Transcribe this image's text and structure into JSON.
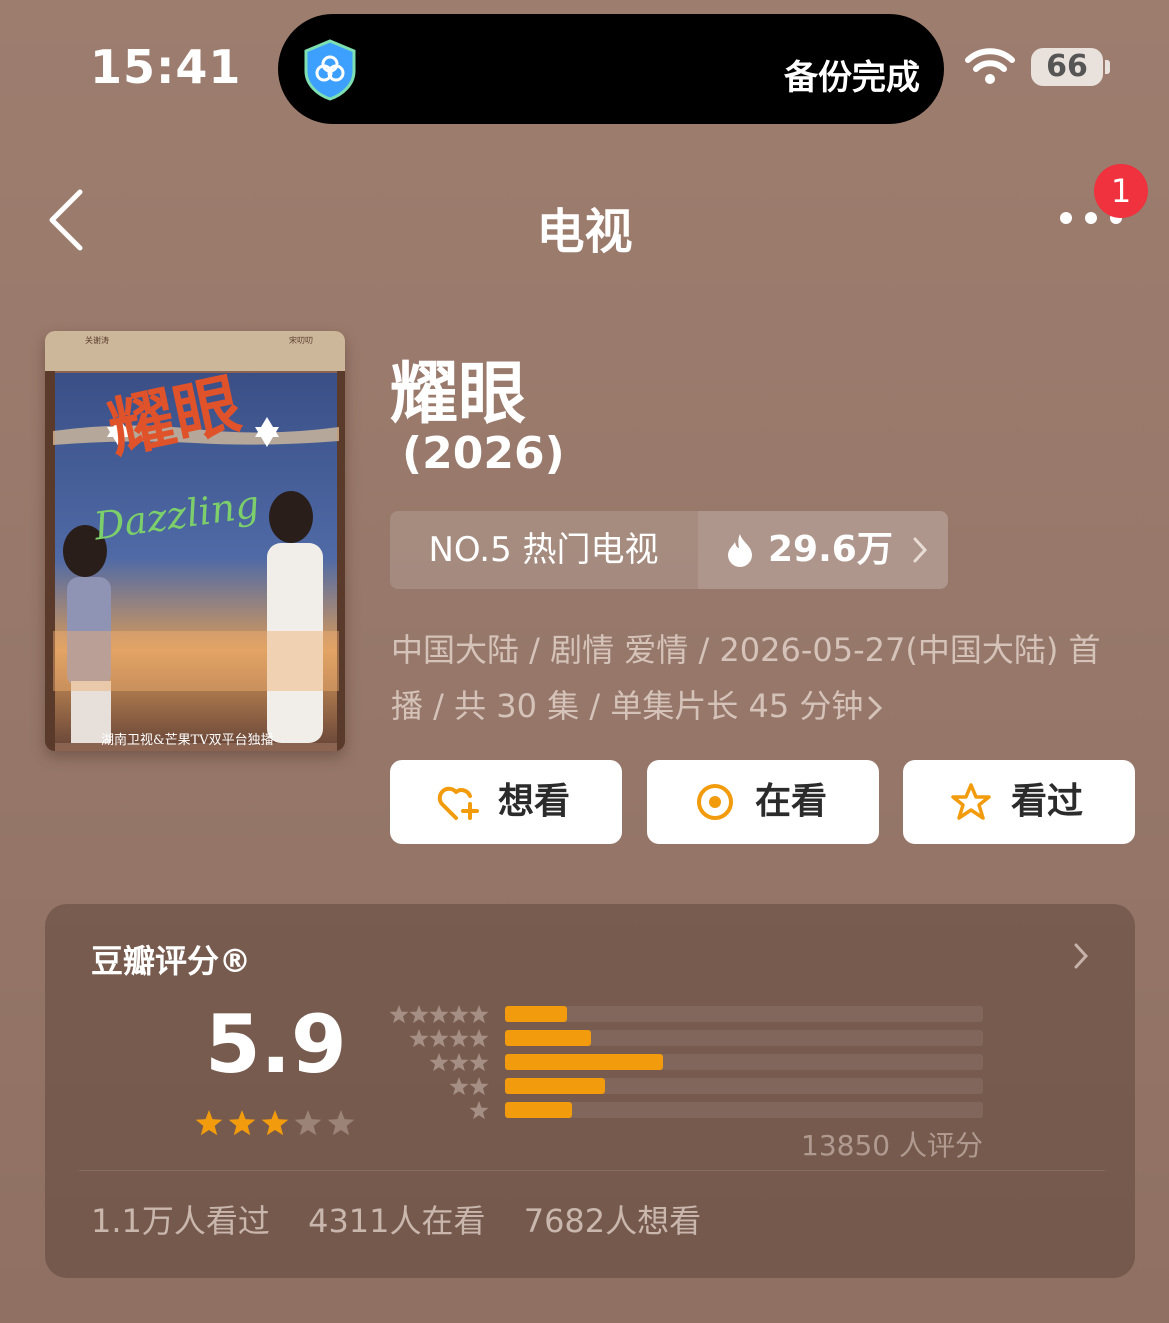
{
  "status_bar": {
    "time": "15:41",
    "backup_status": "备份完成",
    "battery": "66"
  },
  "nav": {
    "title": "电视",
    "notification_count": "1"
  },
  "poster": {
    "credits_left": "关谢涛",
    "credits_right": "宋叨叨",
    "title_art": "耀眼",
    "english_title": "Dazzling",
    "broadcast": "湖南卫视&芒果TV双平台独播"
  },
  "show": {
    "title": "耀眼",
    "year": "(2026)",
    "rank_label": "NO.5 热门电视",
    "hot_count": "29.6万",
    "meta_line1": "中国大陆 / 剧情 爱情 / 2026-05-27(中国大陆) 首",
    "meta_line2": "播 / 共 30 集 / 单集片长 45 分钟"
  },
  "actions": {
    "want": "想看",
    "watching": "在看",
    "watched": "看过"
  },
  "rating": {
    "title": "豆瓣评分®",
    "score": "5.9",
    "star_level": 3,
    "distribution": [
      {
        "stars": 5,
        "fraction": 0.13
      },
      {
        "stars": 4,
        "fraction": 0.18
      },
      {
        "stars": 3,
        "fraction": 0.33
      },
      {
        "stars": 2,
        "fraction": 0.21
      },
      {
        "stars": 1,
        "fraction": 0.14
      }
    ],
    "raters": "13850 人评分",
    "watched_count": "1.1万人看过",
    "watching_count": "4311人在看",
    "want_count": "7682人想看"
  },
  "colors": {
    "accent": "#f29b0d",
    "badge": "#f0313e",
    "shield": "#2e8bff"
  }
}
